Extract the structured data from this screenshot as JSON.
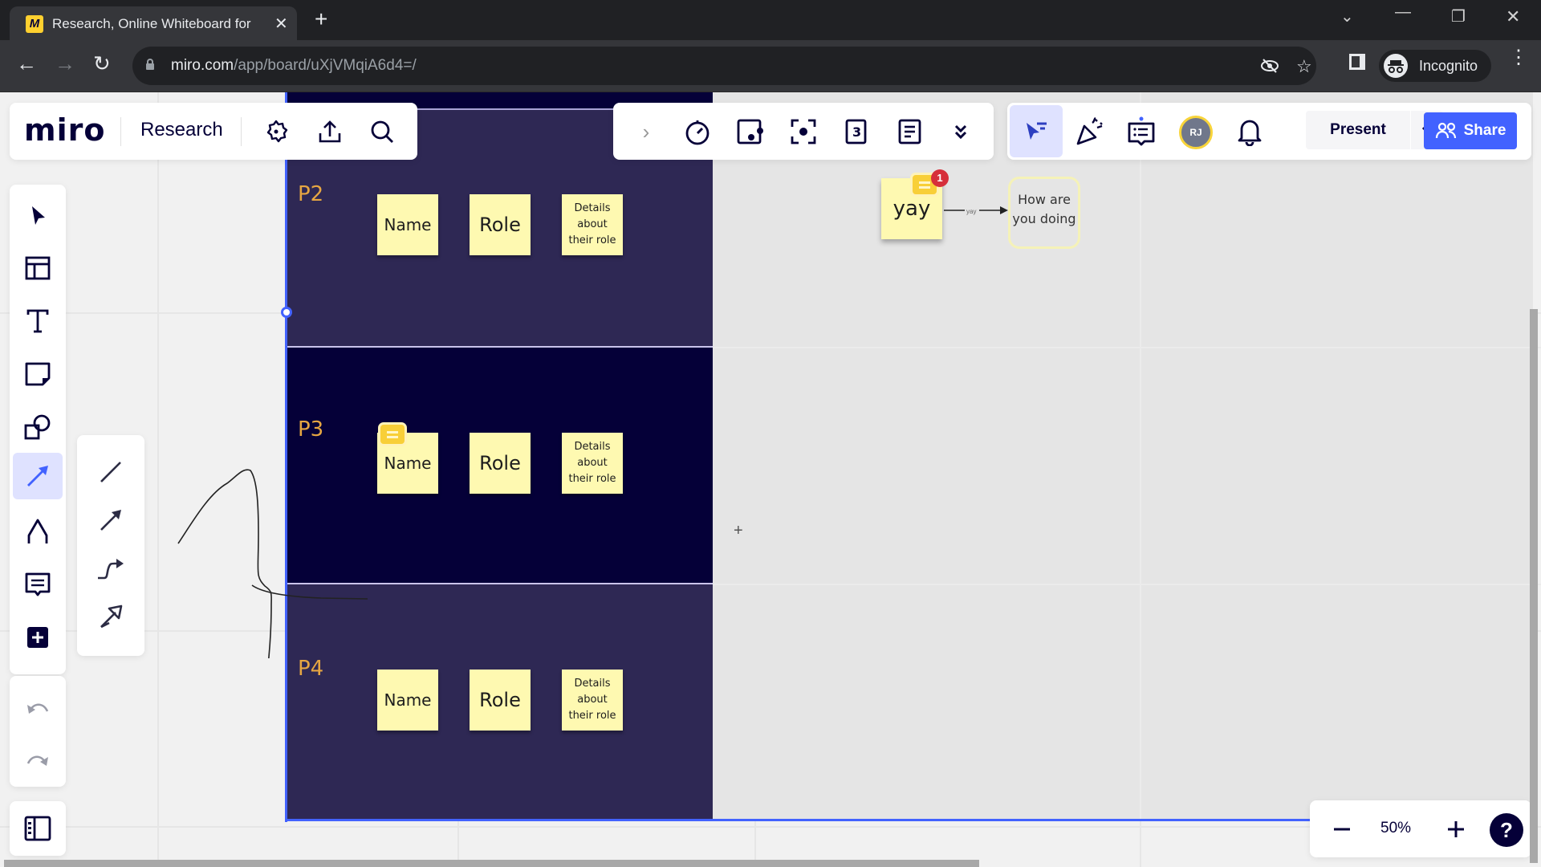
{
  "browser": {
    "tab_title": "Research, Online Whiteboard for",
    "tab_favicon": "miro-logo-icon",
    "new_tab_label": "+",
    "url_host": "miro.com",
    "url_path": "/app/board/uXjVMqiA6d4=/",
    "profile_label": "Incognito",
    "window_controls": [
      "tab-search",
      "minimize",
      "restore",
      "close"
    ]
  },
  "miro": {
    "logo": "miro",
    "board_name": "Research",
    "top_left_icons": [
      "gear-icon",
      "upload-icon",
      "search-icon"
    ],
    "center_toolbar_icons": [
      "collapse-chevron-icon",
      "timer-icon",
      "video-chat-icon",
      "attention-focus-icon",
      "card-count-icon",
      "notes-icon",
      "more-chevrons-icon"
    ],
    "right_toolbar": {
      "icons": [
        "reactions-cursor-icon",
        "celebrate-icon",
        "comments-icon"
      ],
      "avatar_initials": "RJ",
      "present_label": "Present",
      "share_label": "Share"
    },
    "left_toolbar": [
      "select-tool",
      "templates-tool",
      "text-tool",
      "sticky-note-tool",
      "shapes-tool",
      "connection-line-tool",
      "pen-tool",
      "comment-tool",
      "add-more-tool"
    ],
    "active_tool": "connection-line-tool",
    "line_submenu": [
      "straight-line",
      "arrow-line",
      "elbow-connector",
      "curved-arrow"
    ],
    "zoom": {
      "level": "50%",
      "minus": "−",
      "plus": "+",
      "help": "?"
    }
  },
  "board": {
    "rows": [
      {
        "label": "P2",
        "stickies": [
          "Name",
          "Role",
          "Details about their role"
        ],
        "has_comment": false
      },
      {
        "label": "P3",
        "stickies": [
          "Name",
          "Role",
          "Details about their role"
        ],
        "has_comment": true
      },
      {
        "label": "P4",
        "stickies": [
          "Name",
          "Role",
          "Details about their role"
        ],
        "has_comment": false
      }
    ],
    "yay_sticky": "yay",
    "yay_notification_count": "1",
    "connector_label": "yay",
    "target_text": "How are you doing"
  },
  "colors": {
    "accent": "#4262ff",
    "frame_row_light": "#2e2854",
    "frame_row_dark": "#050038",
    "sticky_yellow": "#fef9b1",
    "row_label": "#e6a642"
  }
}
